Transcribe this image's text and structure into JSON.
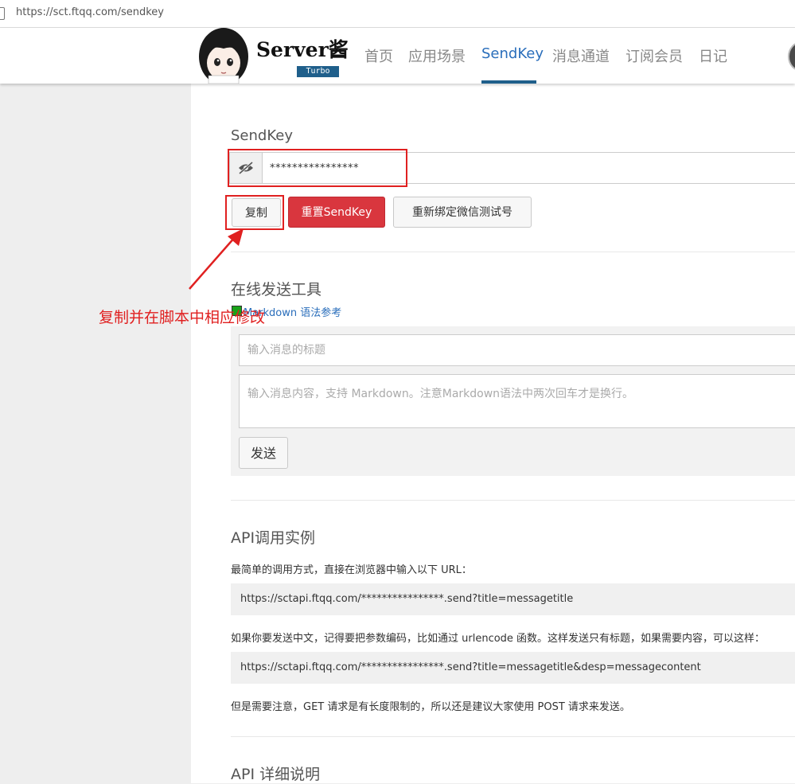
{
  "browser": {
    "url": "https://sct.ftqq.com/sendkey"
  },
  "brand": {
    "title": "Server酱",
    "badge": "Turbo"
  },
  "nav": {
    "items": [
      {
        "label": "首页",
        "active": false
      },
      {
        "label": "应用场景",
        "active": false
      },
      {
        "label": "SendKey",
        "active": true
      },
      {
        "label": "消息通道",
        "active": false
      },
      {
        "label": "订阅会员",
        "active": false
      },
      {
        "label": "日记",
        "active": false
      }
    ]
  },
  "sendkey": {
    "label": "SendKey",
    "masked_value": "****************",
    "copy_label": "复制",
    "reset_label": "重置SendKey",
    "rebind_label": "重新绑定微信测试号"
  },
  "annotation": {
    "text": "复制并在脚本中相应修改",
    "color": "#e02020"
  },
  "online_tool": {
    "title": "在线发送工具",
    "markdown_link": "Markdown 语法参考",
    "title_placeholder": "输入消息的标题",
    "content_placeholder": "输入消息内容，支持 Markdown。注意Markdown语法中两次回车才是换行。",
    "send_label": "发送"
  },
  "api_example": {
    "title": "API调用实例",
    "intro": "最简单的调用方式，直接在浏览器中输入以下 URL：",
    "url1": "https://sctapi.ftqq.com/****************.send?title=messagetitle",
    "note": "如果你要发送中文，记得要把参数编码，比如通过 urlencode 函数。这样发送只有标题，如果需要内容，可以这样：",
    "url2": "https://sctapi.ftqq.com/****************.send?title=messagetitle&desp=messagecontent",
    "post_note": "但是需要注意，GET 请求是有长度限制的，所以还是建议大家使用 POST 请求来发送。"
  },
  "api_detail": {
    "title": "API 详细说明"
  },
  "colors": {
    "accent": "#1f5f8b",
    "link": "#2a6ebb",
    "danger": "#d9363e",
    "highlight": "#e02020"
  }
}
